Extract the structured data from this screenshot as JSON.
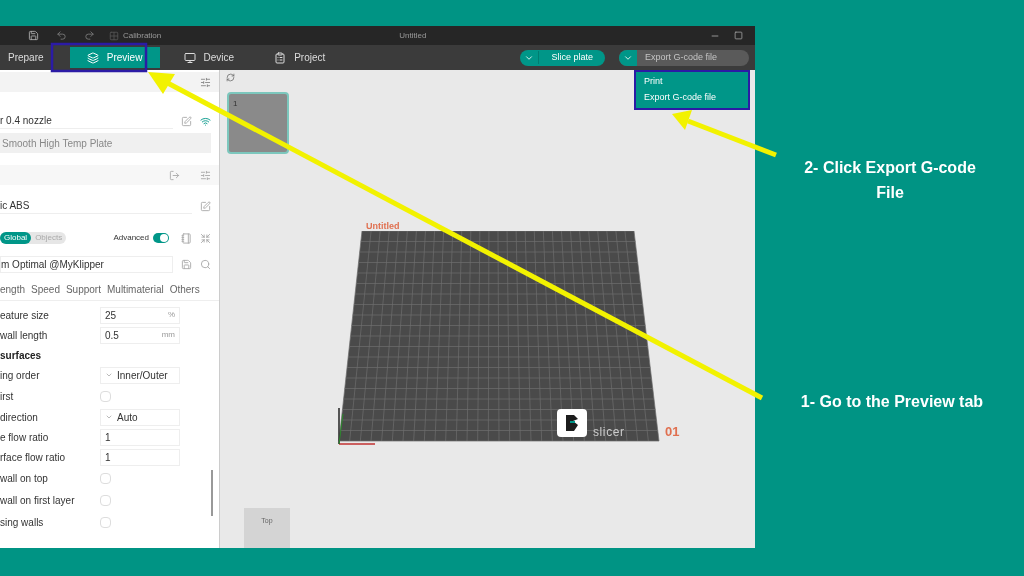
{
  "window": {
    "title": "Untitled",
    "calibration": "Calibration"
  },
  "tabs": [
    {
      "label": "Prepare",
      "selected": false
    },
    {
      "label": "Preview",
      "selected": true
    },
    {
      "label": "Device",
      "selected": false
    },
    {
      "label": "Project",
      "selected": false
    }
  ],
  "actions": {
    "slice": {
      "label": "Slice plate",
      "disabled": false
    },
    "export": {
      "label": "Export G-code file",
      "disabled": true
    }
  },
  "menu": {
    "items": [
      "Print",
      "Export G-code file"
    ]
  },
  "sidebar": {
    "printer": "r 0.4 nozzle",
    "plate": "Smooth High Temp Plate",
    "filament": "ic ABS",
    "scope": [
      {
        "label": "Global",
        "selected": true
      },
      {
        "label": "Objects",
        "selected": false
      }
    ],
    "advanced": {
      "label": "Advanced",
      "on": true
    },
    "process": "m Optimal @MyKlipper",
    "tabs": [
      "ength",
      "Speed",
      "Support",
      "Multimaterial",
      "Others"
    ],
    "settings": [
      {
        "kind": "number",
        "label": "eature size",
        "value": "25",
        "unit": "%"
      },
      {
        "kind": "number",
        "label": "wall length",
        "value": "0.5",
        "unit": "mm"
      },
      {
        "kind": "heading",
        "label": "surfaces"
      },
      {
        "kind": "dropdown",
        "label": "ing order",
        "value": "Inner/Outer"
      },
      {
        "kind": "checkbox",
        "label": "irst",
        "checked": false
      },
      {
        "kind": "dropdown",
        "label": "direction",
        "value": "Auto"
      },
      {
        "kind": "number",
        "label": "e flow ratio",
        "value": "1"
      },
      {
        "kind": "number",
        "label": "rface flow ratio",
        "value": "1"
      },
      {
        "kind": "checkbox",
        "label": "wall on top",
        "checked": false
      },
      {
        "kind": "checkbox",
        "label": "wall on first layer",
        "checked": false
      },
      {
        "kind": "checkbox",
        "label": "sing walls",
        "checked": false
      }
    ]
  },
  "viewport": {
    "plate_number": "1",
    "bed_label": "Untitled",
    "logo_text": "slicer",
    "bed_number": "01",
    "view_cube": "Top"
  },
  "callouts": [
    "2- Click Export G-code File",
    "1- Go to the Preview tab"
  ]
}
